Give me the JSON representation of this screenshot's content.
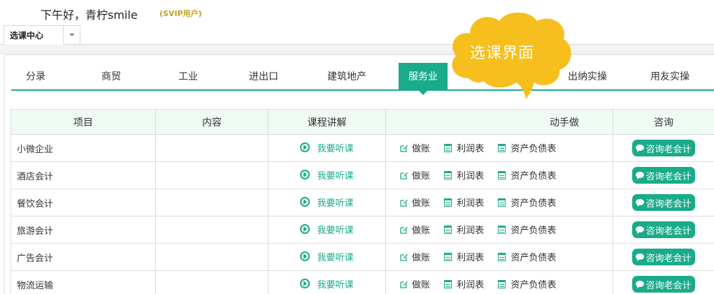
{
  "header": {
    "greeting": "下午好，青柠smile",
    "badge": "(SVIP用户)"
  },
  "tabs": {
    "active_label": "选课中心",
    "dropdown_icon": "chevron-down-icon"
  },
  "callout": {
    "text": "选课界面",
    "color": "#f6bf1e"
  },
  "categories": [
    {
      "label": "分录"
    },
    {
      "label": "商贸"
    },
    {
      "label": "工业"
    },
    {
      "label": "进出口"
    },
    {
      "label": "建筑地产"
    },
    {
      "label": "服务业",
      "active": true
    },
    {
      "label": "出纳实操"
    },
    {
      "label": "用友实操"
    }
  ],
  "table": {
    "headers": [
      "项目",
      "内容",
      "课程讲解",
      "动手做",
      "咨询"
    ],
    "rows": [
      {
        "project": "小微企业",
        "content": "",
        "listen": "我要听课",
        "actions": [
          "做账",
          "利润表",
          "资产负债表"
        ],
        "consult": "咨询老会计"
      },
      {
        "project": "酒店会计",
        "content": "",
        "listen": "我要听课",
        "actions": [
          "做账",
          "利润表",
          "资产负债表"
        ],
        "consult": "咨询老会计"
      },
      {
        "project": "餐饮会计",
        "content": "",
        "listen": "我要听课",
        "actions": [
          "做账",
          "利润表",
          "资产负债表"
        ],
        "consult": "咨询老会计"
      },
      {
        "project": "旅游会计",
        "content": "",
        "listen": "我要听课",
        "actions": [
          "做账",
          "利润表",
          "资产负债表"
        ],
        "consult": "咨询老会计"
      },
      {
        "project": "广告会计",
        "content": "",
        "listen": "我要听课",
        "actions": [
          "做账",
          "利润表",
          "资产负债表"
        ],
        "consult": "咨询老会计"
      },
      {
        "project": "物流运输",
        "content": "",
        "listen": "我要听课",
        "actions": [
          "做账",
          "利润表",
          "资产负债表"
        ],
        "consult": "咨询老会计"
      }
    ]
  },
  "colors": {
    "accent": "#1aab8a",
    "header_bg": "#eefaf3",
    "badge": "#c8a21a"
  }
}
